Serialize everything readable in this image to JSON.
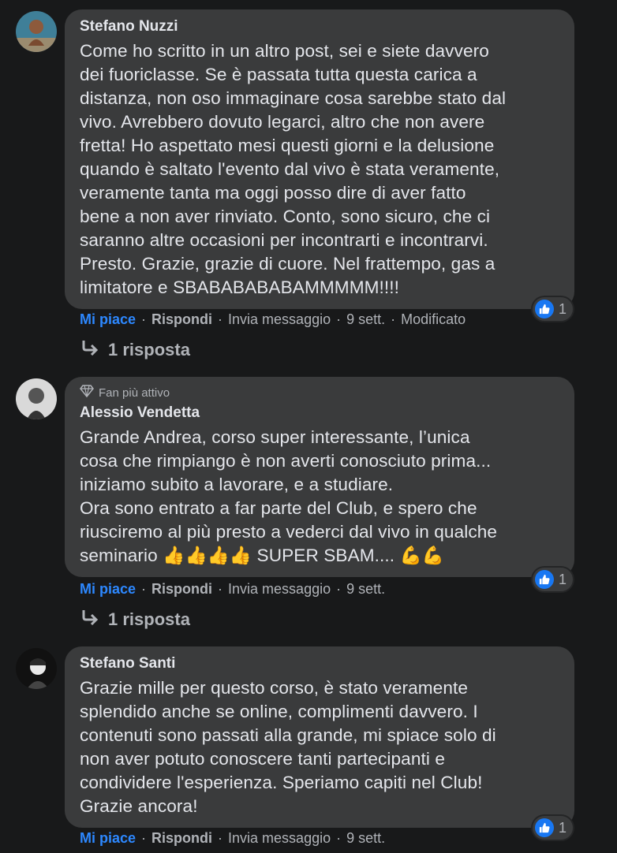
{
  "comments": [
    {
      "author": "Stefano Nuzzi",
      "badge": "",
      "body": "Come ho scritto in un altro post, sei e siete davvero\ndei fuoriclasse. Se è passata tutta questa carica a\ndistanza, non oso immaginare cosa sarebbe stato dal\nvivo. Avrebbero dovuto legarci, altro che non avere\nfretta! Ho aspettato mesi questi giorni e la delusione\nquando è saltato l'evento dal vivo è stata veramente,\nveramente tanta ma oggi posso dire di aver fatto\nbene a non aver rinviato. Conto, sono sicuro, che ci\nsaranno altre occasioni per incontrarti e incontrarvi.\nPresto. Grazie, grazie di cuore. Nel frattempo, gas a\nlimitatore e SBABABABABAMMMMM!!!!",
      "like_label": "Mi piace",
      "reply_label": "Rispondi",
      "message_label": "Invia messaggio",
      "time": "9 sett.",
      "edited": "Modificato",
      "reaction_count": "1",
      "replies_label": "1 risposta"
    },
    {
      "author": "Alessio Vendetta",
      "badge": "Fan più attivo",
      "body": "Grande Andrea, corso super interessante, l’unica\ncosa che rimpiango è non averti conosciuto prima...\niniziamo subito a lavorare, e a studiare.\nOra sono entrato a far parte del Club, e spero che\nriusciremo al più presto a vederci dal vivo in qualche\nseminario 👍👍👍👍 SUPER SBAM.... 💪💪",
      "like_label": "Mi piace",
      "reply_label": "Rispondi",
      "message_label": "Invia messaggio",
      "time": "9 sett.",
      "reaction_count": "1",
      "replies_label": "1 risposta"
    },
    {
      "author": "Stefano Santi",
      "badge": "",
      "body": "Grazie mille per questo corso, è stato veramente\nsplendido anche se online, complimenti davvero. I\ncontenuti sono passati alla grande, mi spiace solo di\nnon aver potuto conoscere tanti partecipanti e\ncondividere l'esperienza. Speriamo capiti nel Club!\nGrazie ancora!",
      "like_label": "Mi piace",
      "reply_label": "Rispondi",
      "message_label": "Invia messaggio",
      "time": "9 sett.",
      "reaction_count": "1"
    }
  ],
  "icons": {
    "like": "thumbs-up-icon",
    "reply_arrow": "reply-arrow-icon",
    "badge": "diamond-icon"
  },
  "colors": {
    "background": "#18191a",
    "bubble": "#3a3b3c",
    "link_blue": "#2d88ff",
    "like_blue": "#1877f2"
  }
}
